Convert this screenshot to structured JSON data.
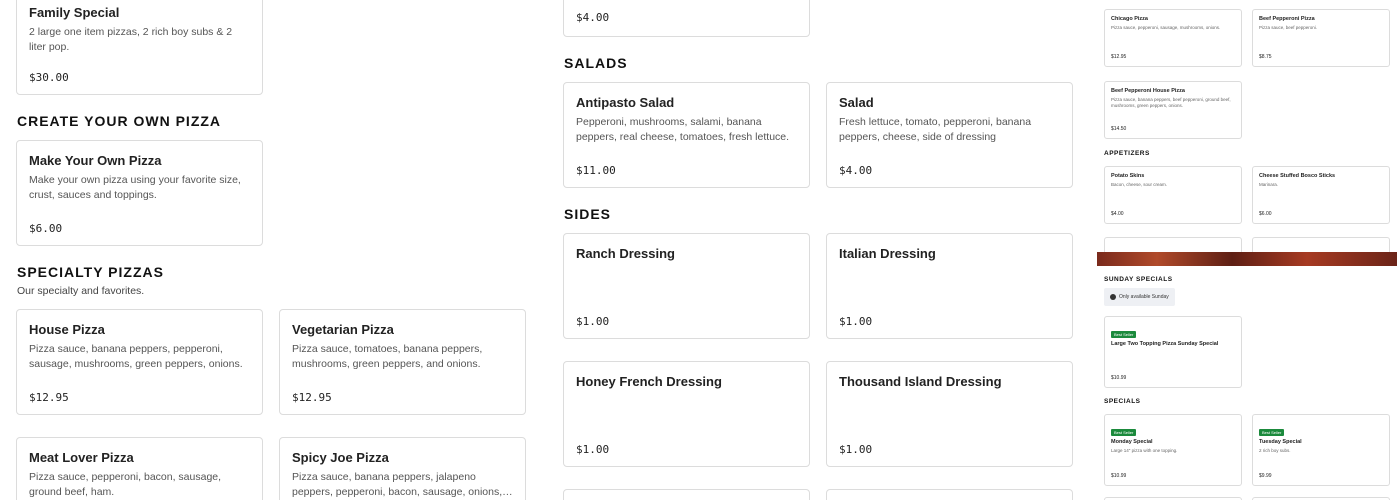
{
  "left": {
    "family_special": {
      "title": "Family Special",
      "desc": "2 large one item pizzas, 2 rich boy subs & 2 liter pop.",
      "price": "$30.00"
    },
    "create_section": {
      "title": "CREATE YOUR OWN PIZZA"
    },
    "make_your_own": {
      "title": "Make Your Own Pizza",
      "desc": "Make your own pizza using your favorite size, crust, sauces and toppings.",
      "price": "$6.00"
    },
    "specialty_section": {
      "title": "SPECIALTY PIZZAS",
      "subtitle": "Our specialty and favorites."
    },
    "house_pizza": {
      "title": "House Pizza",
      "desc": "Pizza sauce, banana peppers, pepperoni, sausage, mushrooms, green peppers, onions.",
      "price": "$12.95"
    },
    "vegetarian_pizza": {
      "title": "Vegetarian Pizza",
      "desc": "Pizza sauce, tomatoes, banana peppers, mushrooms, green peppers, and onions.",
      "price": "$12.95"
    },
    "meat_lover": {
      "title": "Meat Lover Pizza",
      "desc": "Pizza sauce, pepperoni, bacon, sausage, ground beef, ham."
    },
    "spicy_joe": {
      "title": "Spicy Joe Pizza",
      "desc": "Pizza sauce, banana peppers, jalapeno peppers, pepperoni, bacon, sausage, onions, crushed red..."
    }
  },
  "middle": {
    "top_price": "$4.00",
    "salads_section": {
      "title": "SALADS"
    },
    "antipasto": {
      "title": "Antipasto Salad",
      "desc": "Pepperoni, mushrooms, salami, banana peppers, real cheese, tomatoes, fresh lettuce.",
      "price": "$11.00"
    },
    "salad": {
      "title": "Salad",
      "desc": "Fresh lettuce, tomato, pepperoni, banana peppers, cheese, side of dressing",
      "price": "$4.00"
    },
    "sides_section": {
      "title": "SIDES"
    },
    "ranch": {
      "title": "Ranch Dressing",
      "price": "$1.00"
    },
    "italian": {
      "title": "Italian Dressing",
      "price": "$1.00"
    },
    "honey_french": {
      "title": "Honey French Dressing",
      "price": "$1.00"
    },
    "thousand_island": {
      "title": "Thousand Island Dressing",
      "price": "$1.00"
    }
  },
  "right": {
    "chicago": {
      "title": "Chicago Pizza",
      "desc": "Pizza sauce, pepperoni, sausage, mushrooms, onions.",
      "price": "$12.95"
    },
    "beef_pepperoni": {
      "title": "Beef Pepperoni Pizza",
      "desc": "Pizza sauce, beef pepperoni.",
      "price": "$8.75"
    },
    "beef_pepperoni_house": {
      "title": "Beef Pepperoni House Pizza",
      "desc": "Pizza sauce, banana peppers, beef pepperoni, ground beef, mushrooms, green peppers, onions.",
      "price": "$14.50"
    },
    "appetizers_section": "APPETIZERS",
    "potato_skins": {
      "title": "Potato Skins",
      "desc": "Bacon, cheese, sour cream.",
      "price": "$4.00"
    },
    "cheese_sticks": {
      "title": "Cheese Stuffed Bosco Sticks",
      "desc": "Marinara.",
      "price": "$6.00"
    },
    "sunday_section": "SUNDAY SPECIALS",
    "only_sunday": "Only available Sunday",
    "sunday_special": {
      "badge": "Best Seller",
      "title": "Large Two Topping Pizza Sunday Special",
      "price": "$10.99"
    },
    "specials_section": "SPECIALS",
    "monday_special": {
      "badge": "Best Seller",
      "title": "Monday Special",
      "desc": "Large 14\" pizza with one topping.",
      "price": "$10.99"
    },
    "tuesday_special": {
      "badge": "Best Seller",
      "title": "Tuesday Special",
      "desc": "2 rich boy subs.",
      "price": "$9.99"
    }
  },
  "colors": {
    "badge": "#1b8a3c",
    "border": "#dcdcdc"
  }
}
